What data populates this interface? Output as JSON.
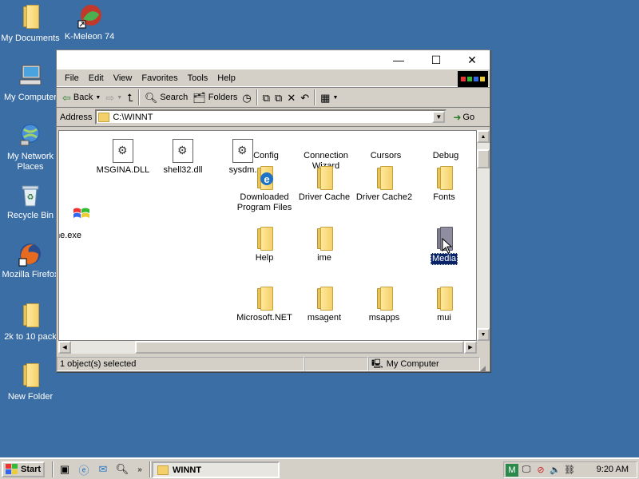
{
  "desktop": {
    "icons": [
      {
        "label": "My Documents"
      },
      {
        "label": "K-Meleon 74"
      },
      {
        "label": "My Computer"
      },
      {
        "label": "My Network Places"
      },
      {
        "label": "Recycle Bin"
      },
      {
        "label": "Mozilla Firefox"
      },
      {
        "label": "2k to 10 pack"
      },
      {
        "label": "New Folder"
      }
    ]
  },
  "window": {
    "controls": {
      "minimize": "—",
      "maximize": "☐",
      "close": "✕"
    },
    "menu": [
      "File",
      "Edit",
      "View",
      "Favorites",
      "Tools",
      "Help"
    ],
    "toolbar": {
      "back": "Back",
      "search": "Search",
      "folders": "Folders"
    },
    "address": {
      "label": "Address",
      "value": "C:\\WINNT",
      "go": "Go"
    },
    "items": [
      {
        "label": "MSGINA.DLL"
      },
      {
        "label": "shell32.dll"
      },
      {
        "label": "sysdm."
      },
      {
        "label": "me.exe"
      },
      {
        "label": "Config"
      },
      {
        "label": "Connection Wizard"
      },
      {
        "label": "Cursors"
      },
      {
        "label": "Debug"
      },
      {
        "label": "Downloaded Program Files"
      },
      {
        "label": "Driver Cache"
      },
      {
        "label": "Driver Cache2"
      },
      {
        "label": "Fonts"
      },
      {
        "label": "Help"
      },
      {
        "label": "ime"
      },
      {
        "label": "Media"
      },
      {
        "label": "Microsoft.NET"
      },
      {
        "label": "msagent"
      },
      {
        "label": "msapps"
      },
      {
        "label": "mui"
      }
    ],
    "status": {
      "selected": "1 object(s) selected",
      "zone": "My Computer"
    }
  },
  "taskbar": {
    "start": "Start",
    "task": "WINNT",
    "clock": "9:20 AM"
  }
}
